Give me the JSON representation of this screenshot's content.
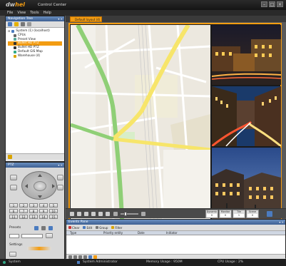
{
  "app": {
    "logo_text": "dwhel",
    "title": "Control Center"
  },
  "menu": [
    "File",
    "View",
    "Tools",
    "Help"
  ],
  "navigation_tree": {
    "title": "Navigation Tree",
    "nodes": [
      {
        "label": "System (1) (localhost)",
        "level": 0,
        "icon": "system-icon"
      },
      {
        "label": "CPUs",
        "level": 1,
        "icon": "cpu-icon"
      },
      {
        "label": "Preset View",
        "level": 1,
        "icon": "view-icon"
      },
      {
        "label": "Bullet HD PTZ",
        "level": 1,
        "icon": "camera-icon",
        "selected": true
      },
      {
        "label": "Bullet HD PTZ",
        "level": 1,
        "icon": "camera-icon"
      },
      {
        "label": "Default GIS Map",
        "level": 1,
        "icon": "map-icon"
      },
      {
        "label": "Warehouse (4)",
        "level": 1,
        "icon": "folder-icon"
      }
    ]
  },
  "ptz": {
    "title": "PTZ",
    "presets_label": "Presets",
    "settings_label": "Settings",
    "number_buttons": [
      "1",
      "2",
      "3",
      "4",
      "5",
      "6",
      "7",
      "8",
      "9",
      "10",
      "11",
      "12",
      "13",
      "14",
      "15"
    ]
  },
  "tab": {
    "label": "Default layout (4)"
  },
  "control_bar": {
    "counters": [
      {
        "label": "Dynamic",
        "value": "0"
      },
      {
        "label": "Monitor",
        "value": "0"
      },
      {
        "label": "Tile",
        "value": "1"
      },
      {
        "label": "Scene",
        "value": "0"
      }
    ]
  },
  "events_pane": {
    "title": "Events Pane",
    "toolbar": [
      "Clear",
      "Edit",
      "Group",
      "Filter"
    ],
    "columns": [
      "Type",
      "Priority entity",
      "Date",
      "Initiator"
    ]
  },
  "status_bar": {
    "system": "System",
    "user": "System Administrator",
    "memory": "Memory Usage : 950M",
    "cpu": "CPU Usage : 2%"
  },
  "colors": {
    "accent": "#f39c12",
    "panel_header": "#3d5f92",
    "dark_bg": "#1e1e1e"
  }
}
